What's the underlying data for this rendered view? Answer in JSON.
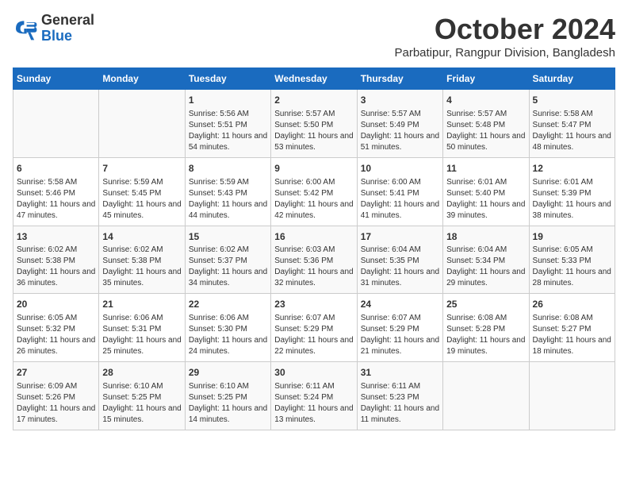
{
  "header": {
    "logo_general": "General",
    "logo_blue": "Blue",
    "month": "October 2024",
    "location": "Parbatipur, Rangpur Division, Bangladesh"
  },
  "days_of_week": [
    "Sunday",
    "Monday",
    "Tuesday",
    "Wednesday",
    "Thursday",
    "Friday",
    "Saturday"
  ],
  "weeks": [
    [
      {
        "day": "",
        "info": ""
      },
      {
        "day": "",
        "info": ""
      },
      {
        "day": "1",
        "info": "Sunrise: 5:56 AM\nSunset: 5:51 PM\nDaylight: 11 hours and 54 minutes."
      },
      {
        "day": "2",
        "info": "Sunrise: 5:57 AM\nSunset: 5:50 PM\nDaylight: 11 hours and 53 minutes."
      },
      {
        "day": "3",
        "info": "Sunrise: 5:57 AM\nSunset: 5:49 PM\nDaylight: 11 hours and 51 minutes."
      },
      {
        "day": "4",
        "info": "Sunrise: 5:57 AM\nSunset: 5:48 PM\nDaylight: 11 hours and 50 minutes."
      },
      {
        "day": "5",
        "info": "Sunrise: 5:58 AM\nSunset: 5:47 PM\nDaylight: 11 hours and 48 minutes."
      }
    ],
    [
      {
        "day": "6",
        "info": "Sunrise: 5:58 AM\nSunset: 5:46 PM\nDaylight: 11 hours and 47 minutes."
      },
      {
        "day": "7",
        "info": "Sunrise: 5:59 AM\nSunset: 5:45 PM\nDaylight: 11 hours and 45 minutes."
      },
      {
        "day": "8",
        "info": "Sunrise: 5:59 AM\nSunset: 5:43 PM\nDaylight: 11 hours and 44 minutes."
      },
      {
        "day": "9",
        "info": "Sunrise: 6:00 AM\nSunset: 5:42 PM\nDaylight: 11 hours and 42 minutes."
      },
      {
        "day": "10",
        "info": "Sunrise: 6:00 AM\nSunset: 5:41 PM\nDaylight: 11 hours and 41 minutes."
      },
      {
        "day": "11",
        "info": "Sunrise: 6:01 AM\nSunset: 5:40 PM\nDaylight: 11 hours and 39 minutes."
      },
      {
        "day": "12",
        "info": "Sunrise: 6:01 AM\nSunset: 5:39 PM\nDaylight: 11 hours and 38 minutes."
      }
    ],
    [
      {
        "day": "13",
        "info": "Sunrise: 6:02 AM\nSunset: 5:38 PM\nDaylight: 11 hours and 36 minutes."
      },
      {
        "day": "14",
        "info": "Sunrise: 6:02 AM\nSunset: 5:38 PM\nDaylight: 11 hours and 35 minutes."
      },
      {
        "day": "15",
        "info": "Sunrise: 6:02 AM\nSunset: 5:37 PM\nDaylight: 11 hours and 34 minutes."
      },
      {
        "day": "16",
        "info": "Sunrise: 6:03 AM\nSunset: 5:36 PM\nDaylight: 11 hours and 32 minutes."
      },
      {
        "day": "17",
        "info": "Sunrise: 6:04 AM\nSunset: 5:35 PM\nDaylight: 11 hours and 31 minutes."
      },
      {
        "day": "18",
        "info": "Sunrise: 6:04 AM\nSunset: 5:34 PM\nDaylight: 11 hours and 29 minutes."
      },
      {
        "day": "19",
        "info": "Sunrise: 6:05 AM\nSunset: 5:33 PM\nDaylight: 11 hours and 28 minutes."
      }
    ],
    [
      {
        "day": "20",
        "info": "Sunrise: 6:05 AM\nSunset: 5:32 PM\nDaylight: 11 hours and 26 minutes."
      },
      {
        "day": "21",
        "info": "Sunrise: 6:06 AM\nSunset: 5:31 PM\nDaylight: 11 hours and 25 minutes."
      },
      {
        "day": "22",
        "info": "Sunrise: 6:06 AM\nSunset: 5:30 PM\nDaylight: 11 hours and 24 minutes."
      },
      {
        "day": "23",
        "info": "Sunrise: 6:07 AM\nSunset: 5:29 PM\nDaylight: 11 hours and 22 minutes."
      },
      {
        "day": "24",
        "info": "Sunrise: 6:07 AM\nSunset: 5:29 PM\nDaylight: 11 hours and 21 minutes."
      },
      {
        "day": "25",
        "info": "Sunrise: 6:08 AM\nSunset: 5:28 PM\nDaylight: 11 hours and 19 minutes."
      },
      {
        "day": "26",
        "info": "Sunrise: 6:08 AM\nSunset: 5:27 PM\nDaylight: 11 hours and 18 minutes."
      }
    ],
    [
      {
        "day": "27",
        "info": "Sunrise: 6:09 AM\nSunset: 5:26 PM\nDaylight: 11 hours and 17 minutes."
      },
      {
        "day": "28",
        "info": "Sunrise: 6:10 AM\nSunset: 5:25 PM\nDaylight: 11 hours and 15 minutes."
      },
      {
        "day": "29",
        "info": "Sunrise: 6:10 AM\nSunset: 5:25 PM\nDaylight: 11 hours and 14 minutes."
      },
      {
        "day": "30",
        "info": "Sunrise: 6:11 AM\nSunset: 5:24 PM\nDaylight: 11 hours and 13 minutes."
      },
      {
        "day": "31",
        "info": "Sunrise: 6:11 AM\nSunset: 5:23 PM\nDaylight: 11 hours and 11 minutes."
      },
      {
        "day": "",
        "info": ""
      },
      {
        "day": "",
        "info": ""
      }
    ]
  ]
}
